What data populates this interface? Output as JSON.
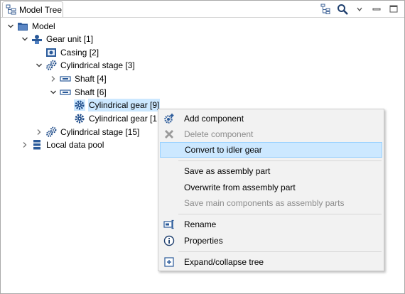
{
  "panel": {
    "tab_title": "Model Tree",
    "tools": [
      "tree-filter-icon",
      "search-icon",
      "view-menu-icon",
      "minimize-icon",
      "maximize-icon"
    ]
  },
  "tree": {
    "root": "Model",
    "gear_unit": "Gear unit [1]",
    "casing": "Casing [2]",
    "stage1": "Cylindrical stage [3]",
    "shaft4": "Shaft [4]",
    "shaft6": "Shaft [6]",
    "gear9": "Cylindrical gear [9]",
    "gear10": "Cylindrical gear [1",
    "stage15": "Cylindrical stage [15]",
    "pool": "Local data pool"
  },
  "menu": {
    "add_component": "Add component",
    "delete_component": "Delete component",
    "convert_idler": "Convert to idler gear",
    "save_assembly": "Save as assembly part",
    "overwrite_assembly": "Overwrite from assembly part",
    "save_main": "Save main components as assembly parts",
    "rename": "Rename",
    "properties": "Properties",
    "expand_collapse": "Expand/collapse tree"
  },
  "colors": {
    "selection": "#cce8ff",
    "menu_bg": "#f2f2f2",
    "gear_blue": "#2a5a9a"
  }
}
